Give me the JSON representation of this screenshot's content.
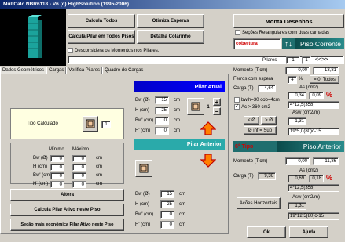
{
  "window": {
    "title": "MultCalc NBR6118 - V6 (c) HighSolution (1995-2006)"
  },
  "toolbar": {
    "calcula_todos": "Calcula Todos",
    "otimiza_esperas": "Otimiza Esperas",
    "monta_desenhos": "Monta Desenhos",
    "calcula_pilar_todos": "Calcula Pilar em Todos Pisos",
    "detalha_colarinho": "Detalha Colarinho",
    "desconsidera_label": "Desconsidera os Momentos nos Pilares.",
    "secoes_label": "Seções Retangulares com duas camadas"
  },
  "floor_nav": {
    "current_floor": "cobertura",
    "arrows": "↑↓",
    "title": "Piso Corrente"
  },
  "tabs": [
    "Dados Geométricos",
    "Cargas",
    "Verifica Pilares",
    "Quadro de Cargas"
  ],
  "pilar_atual": {
    "title": "Pilar Atual",
    "tipo_label": "Tipo Calculado",
    "tipo_value": "1",
    "bw_label": "Bw (Ø)",
    "bw_value": "15",
    "bw_unit": "cm",
    "h_label": "H (cm)",
    "h_value": "25",
    "h_unit": "cm",
    "bwp_label": "Bw' (cm)",
    "bwp_value": "0",
    "bwp_unit": "cm",
    "hp_label": "H' (cm)",
    "hp_value": "0",
    "hp_unit": "cm",
    "icon_value": "1"
  },
  "minmax": {
    "min_header": "Mínimo",
    "max_header": "Máximo",
    "rows": [
      {
        "label": "Bw (Ø)",
        "min": "0",
        "max": "0",
        "unit": "cm"
      },
      {
        "label": "H (cm)",
        "min": "0",
        "max": "0",
        "unit": "cm"
      },
      {
        "label": "Bw' (cm)",
        "min": "0",
        "max": "0",
        "unit": "cm"
      },
      {
        "label": "H' (cm)",
        "min": "0",
        "max": "0",
        "unit": "cm"
      }
    ]
  },
  "pilar_anterior": {
    "title": "Pilar Anterior",
    "bw_label": "Bw (Ø)",
    "bw_value": "15",
    "bw_unit": "cm",
    "h_label": "H (cm)",
    "h_value": "25",
    "h_unit": "cm",
    "bwp_label": "Bw' (cm)",
    "bwp_value": "0",
    "bwp_unit": "cm",
    "hp_label": "H' (cm)",
    "hp_value": "0",
    "hp_unit": "cm"
  },
  "actions": {
    "altera": "Altera",
    "calcula_pilar_ativo": "Calcula Pilar Ativo neste Piso",
    "secao_economica": "Seção mais econômica  Pilar Ativo neste Piso"
  },
  "right_panel": {
    "pilares_label": "Pilares",
    "pilares_value": "1",
    "pilares_count": "1",
    "nav_icons": "<<>>",
    "momento_label": "Momento (T.cm)",
    "momento_1": "0,00",
    "momento_2": "13,81",
    "ferros_label": "Ferros com espera",
    "ferros_value": "4",
    "ferros_pct": "%",
    "ferros_total": "= 0, Todos",
    "carga_label": "Carga (T)",
    "carga_value": "4,64",
    "bw_check": "bw,h=30 cob=4cm",
    "ac_check": "Ac > 360 cm2",
    "as_label_1": "As (cm2)",
    "as_value_1": "0,34",
    "as_pct_1": "0,09",
    "as_pct_sym": "%",
    "as_bars_1": "4*12,5(358)",
    "asw_label_1": "Asw (cm2/m)",
    "asw_value_1": "1,31",
    "asw_bars_1": "19*5,0(80)c-15",
    "op_lt": "< Ø",
    "op_gt": "> Ø",
    "op_inf": "Ø inf = Sup",
    "tipo_anterior": "6° Tipo",
    "piso_anterior": "Piso Anterior",
    "momento_2_label": "Momento (T.cm)",
    "momento_2_1": "0,00",
    "momento_2_2": "11,86",
    "carga_2_label": "Carga (T)",
    "carga_2_value": "9,36",
    "as_label_2": "As (cm2)",
    "as_value_2": "0,69",
    "as_pct_2": "0,18",
    "as_bars_2": "4*12,5(358)",
    "acoes_button": "Ações Horizontais",
    "asw_label_2": "Asw (cm2/m)",
    "asw_value_2": "1,31",
    "asw_bars_2": "19*12,5(80)c-15",
    "ok_button": "Ok",
    "ajuda_button": "Ajuda"
  },
  "colors": {
    "blue_title": "#0000ff",
    "teal_title": "#1f6e6e",
    "red": "#d00000",
    "arrow_orange": "#ff8000"
  }
}
